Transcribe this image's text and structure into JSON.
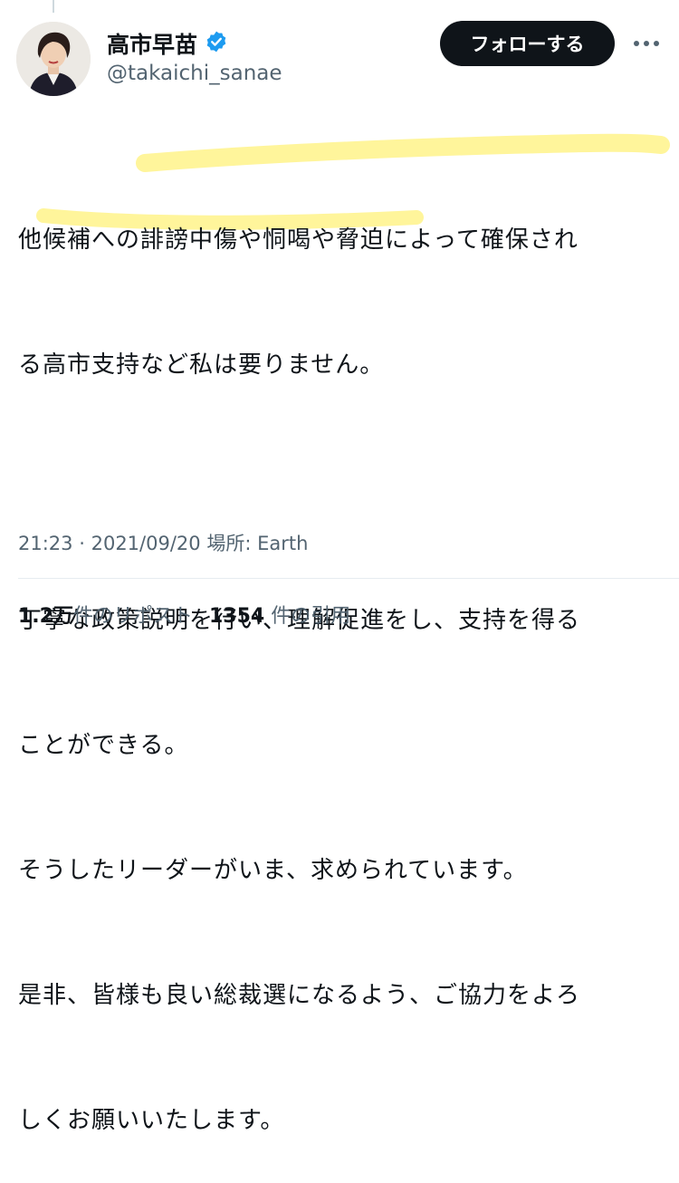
{
  "author": {
    "display_name": "高市早苗",
    "handle": "@takaichi_sanae",
    "verified_icon": "verified-badge-icon"
  },
  "actions": {
    "follow_label": "フォローする",
    "more_icon": "more-icon"
  },
  "tweet": {
    "lines": [
      "他候補への誹謗中傷や恫喝や脅迫によって確保され",
      "る高市支持など私は要りません。",
      "",
      "丁寧な政策説明を行い、理解促進をし、支持を得る",
      "ことができる。",
      "そうしたリーダーがいま、求められています。",
      "是非、皆様も良い総裁選になるよう、ご協力をよろ",
      "しくお願いいたします。"
    ],
    "highlight_color": "#fff59a"
  },
  "meta": {
    "time": "21:23",
    "separator": "·",
    "date": "2021/09/20",
    "location": "場所: Earth"
  },
  "stats": {
    "reposts_count": "1.2万",
    "reposts_label": "件のリポスト",
    "quotes_count": "1354",
    "quotes_label": "件の引用"
  },
  "colors": {
    "verified": "#1d9bf0",
    "follow_bg": "#0f1419",
    "secondary_text": "#536471"
  }
}
